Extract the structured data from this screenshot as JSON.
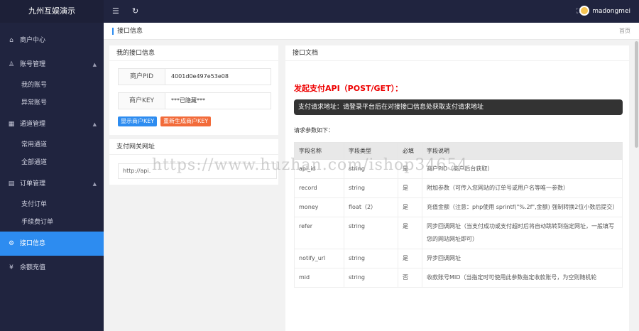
{
  "app": {
    "brand": "九州互娱演示"
  },
  "sidebar": {
    "items": [
      {
        "label": "商户中心",
        "icon": "home-icon"
      },
      {
        "label": "账号管理",
        "icon": "user-icon"
      },
      {
        "label": "通道管理",
        "icon": "channel-icon"
      },
      {
        "label": "订单管理",
        "icon": "order-icon"
      },
      {
        "label": "接口信息",
        "icon": "api-icon"
      },
      {
        "label": "余额充值",
        "icon": "yen-icon"
      }
    ],
    "account_sub": [
      "我的账号",
      "异常账号"
    ],
    "channel_sub": [
      "常用通道",
      "全部通道"
    ],
    "order_sub": [
      "支付订单",
      "手续费订单"
    ]
  },
  "topbar": {
    "username": "madongmei"
  },
  "crumb": {
    "title": "接口信息",
    "home": "首页"
  },
  "my_api": {
    "title": "我的接口信息",
    "pid_label": "商户PID",
    "pid_value": "4001d0e497e53e08",
    "key_label": "商户KEY",
    "key_value": "***已隐藏***",
    "show_key_btn": "显示商户KEY",
    "regen_key_btn": "重新生成商户KEY"
  },
  "gateway": {
    "title": "支付网关网址",
    "value": "http://api."
  },
  "docs": {
    "title": "接口文档",
    "heading": "发起支付API（POST/GET）：",
    "tip": "支付请求地址：请登录平台后在对接接口信息处获取支付请求地址",
    "params_intro": "请求参数如下：",
    "columns": [
      "字段名称",
      "字段类型",
      "必填",
      "字段说明"
    ],
    "rows": [
      [
        "api_id",
        "string",
        "是",
        "商户PID（商户后台获取）"
      ],
      [
        "record",
        "string",
        "是",
        "附加参数（可传入您网站的订单号或用户名等唯一参数）"
      ],
      [
        "money",
        "float（2）",
        "是",
        "充值金额（注意：php使用 sprintf(\"%.2f\",金额) 强制转换2位小数后提交）"
      ],
      [
        "refer",
        "string",
        "是",
        "同步回调网址（当支付成功或支付超时后将自动跳转到指定网址，一般填写您的网站网址即可）"
      ],
      [
        "notify_url",
        "string",
        "是",
        "异步回调网址"
      ],
      [
        "mid",
        "string",
        "否",
        "收款账号MID（当指定时可使用此参数指定收款账号，为空则随机轮"
      ]
    ]
  },
  "watermark": "https://www.huzhan.com/ishop34654",
  "colors": {
    "sidebar": "#20243f",
    "accent": "#2d8cf0",
    "danger": "#e00000",
    "orange": "#f26b3a"
  }
}
